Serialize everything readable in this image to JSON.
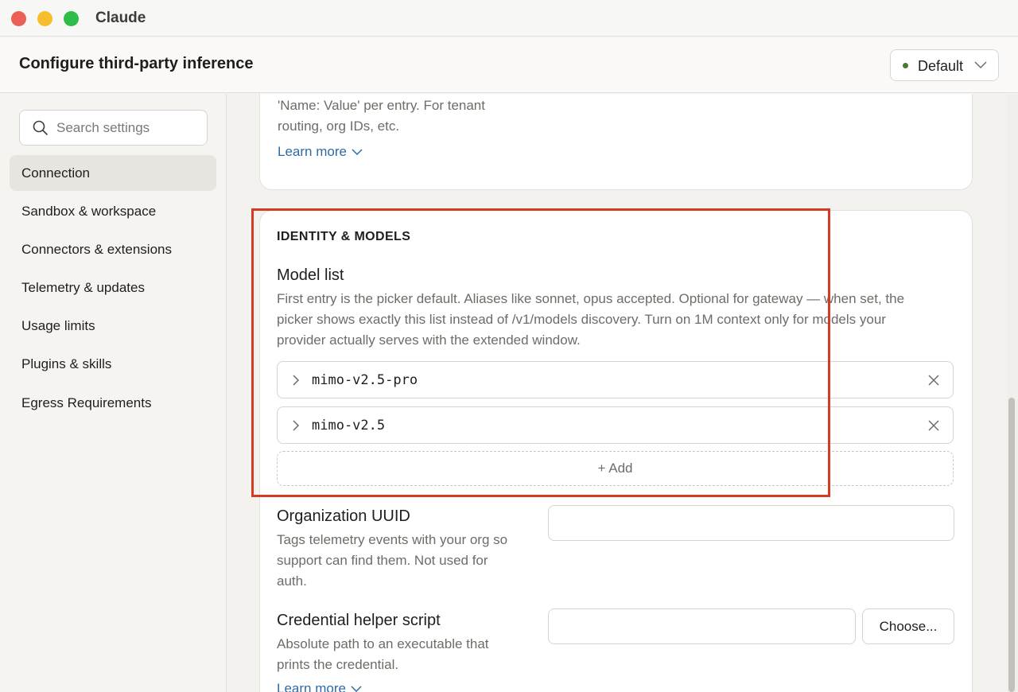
{
  "window": {
    "app_title": "Claude"
  },
  "header": {
    "page_title": "Configure third-party inference",
    "profile_select": {
      "label": "Default",
      "status_color": "#4d7a2a"
    }
  },
  "sidebar": {
    "search": {
      "placeholder": "Search settings",
      "icon": "search-icon"
    },
    "items": [
      {
        "label": "Connection",
        "active": true
      },
      {
        "label": "Sandbox & workspace"
      },
      {
        "label": "Connectors & extensions"
      },
      {
        "label": "Telemetry & updates"
      },
      {
        "label": "Usage limits"
      },
      {
        "label": "Plugins & skills"
      },
      {
        "label": "Egress Requirements"
      }
    ]
  },
  "main": {
    "previous_card": {
      "description_line1": "'Name: Value' per entry. For tenant",
      "description_line2": "routing, org IDs, etc.",
      "learn_more": "Learn more"
    },
    "identity_section": {
      "heading": "IDENTITY & MODELS",
      "model_list": {
        "title": "Model list",
        "description_line1": "First entry is the picker default. Aliases like sonnet, opus accepted. Optional for gateway — when set, the",
        "description_line2": "picker shows exactly this list instead of /v1/models discovery. Turn on 1M context only for models your",
        "description_line3": "provider actually serves with the extended window.",
        "models": [
          "mimo-v2.5-pro",
          "mimo-v2.5"
        ],
        "add_label": "+ Add"
      },
      "organization_uuid": {
        "title": "Organization UUID",
        "description_line1": "Tags telemetry events with your org so",
        "description_line2": "support can find them. Not used for",
        "description_line3": "auth.",
        "value": ""
      },
      "credential_helper": {
        "title": "Credential helper script",
        "description_line1": "Absolute path to an executable that",
        "description_line2": "prints the credential.",
        "value": "",
        "choose_label": "Choose...",
        "learn_more": "Learn more"
      }
    }
  },
  "colors": {
    "accent_link": "#2f6aa6",
    "highlight_border": "#d53a23"
  }
}
